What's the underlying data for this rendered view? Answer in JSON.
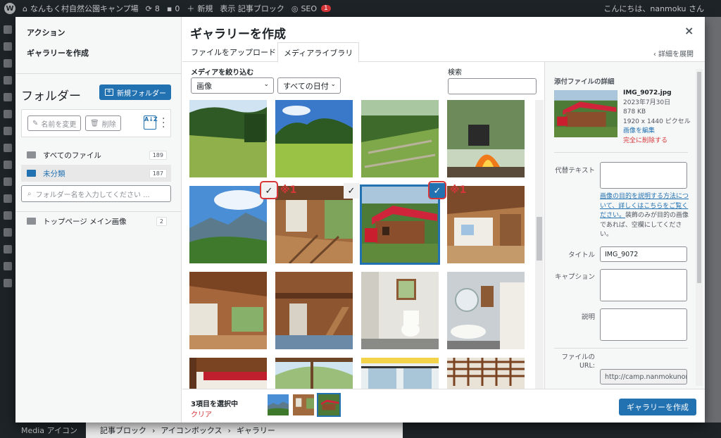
{
  "adminbar": {
    "site_name": "なんもく村自然公園キャンプ場",
    "updates_count": "8",
    "comments_count": "0",
    "new_label": "新規",
    "view_post_label": "表示 記事ブロック",
    "seo_label": "SEO",
    "seo_badge": "1",
    "greeting": "こんにちは、nanmoku さん"
  },
  "menu": {
    "actions_label": "アクション",
    "create_gallery_label": "ギャラリーを作成"
  },
  "folders": {
    "title": "フォルダー",
    "new_folder_label": "新規フォルダー",
    "rename_label": "名前を変更",
    "delete_label": "削除",
    "sort_icon_text": "A↓Z",
    "items": [
      {
        "label": "すべてのファイル",
        "count": "189"
      },
      {
        "label": "未分類",
        "count": "187"
      },
      {
        "label": "トップページ メイン画像",
        "count": "2"
      }
    ],
    "search_placeholder": "フォルダー名を入力してください ..."
  },
  "modal": {
    "title": "ギャラリーを作成",
    "close_label": "×",
    "tabs": [
      {
        "label": "ファイルをアップロード",
        "active": false
      },
      {
        "label": "メディアライブラリ",
        "active": true
      }
    ],
    "expand_label": "詳細を展開",
    "filter_label": "メディアを絞り込む",
    "type_filter": "画像",
    "date_filter": "すべての日付",
    "search_label": "検索",
    "annotation": "※1"
  },
  "thumbs": [
    {
      "name": "meadow-forest",
      "selected": false,
      "check": false
    },
    {
      "name": "grass-field-trees",
      "selected": false,
      "check": false
    },
    {
      "name": "terraced-campsite",
      "selected": false,
      "check": false
    },
    {
      "name": "campfire-pot",
      "selected": false,
      "check": false
    },
    {
      "name": "mountain-view",
      "selected": false,
      "check": true
    },
    {
      "name": "cabin-deck-wood",
      "selected": false,
      "check": true
    },
    {
      "name": "red-roof-cabin",
      "selected": true,
      "check": true
    },
    {
      "name": "cabin-interior-loft",
      "selected": false,
      "check": false
    },
    {
      "name": "interior-ceiling-wood",
      "selected": false,
      "check": false
    },
    {
      "name": "interior-stairs-loft",
      "selected": false,
      "check": false
    },
    {
      "name": "toilet-room",
      "selected": false,
      "check": false
    },
    {
      "name": "washroom-sink",
      "selected": false,
      "check": false
    },
    {
      "name": "interior-beam-red",
      "selected": false,
      "check": false
    },
    {
      "name": "window-view-trees",
      "selected": false,
      "check": false
    },
    {
      "name": "windows-bright",
      "selected": false,
      "check": false
    },
    {
      "name": "lattice-ceiling",
      "selected": false,
      "check": false
    }
  ],
  "details": {
    "heading": "添付ファイルの詳細",
    "filename": "IMG_9072.jpg",
    "date": "2023年7月30日",
    "filesize": "878 KB",
    "dimensions": "1920 x 1440 ピクセル",
    "edit_image_label": "画像を編集",
    "delete_permanently_label": "完全に削除する",
    "alt_label": "代替テキスト",
    "alt_help_link": "画像の目的を説明する方法について、詳しくはこちらをご覧ください。",
    "alt_help_text": "装飾のみが目的の画像であれば、空欄にしてください。",
    "title_label": "タイトル",
    "title_value": "IMG_9072",
    "caption_label": "キャプション",
    "description_label": "説明",
    "url_label": "ファイルの URL:",
    "url_value": "http://camp.nanmokunor"
  },
  "toolbar": {
    "selected_count_label": "3項目を選択中",
    "clear_label": "クリア",
    "create_gallery_button": "ギャラリーを作成"
  },
  "bottom": {
    "media_label": "Media アイコン",
    "crumbs": [
      "記事ブロック",
      "アイコンボックス",
      "ギャラリー"
    ]
  }
}
